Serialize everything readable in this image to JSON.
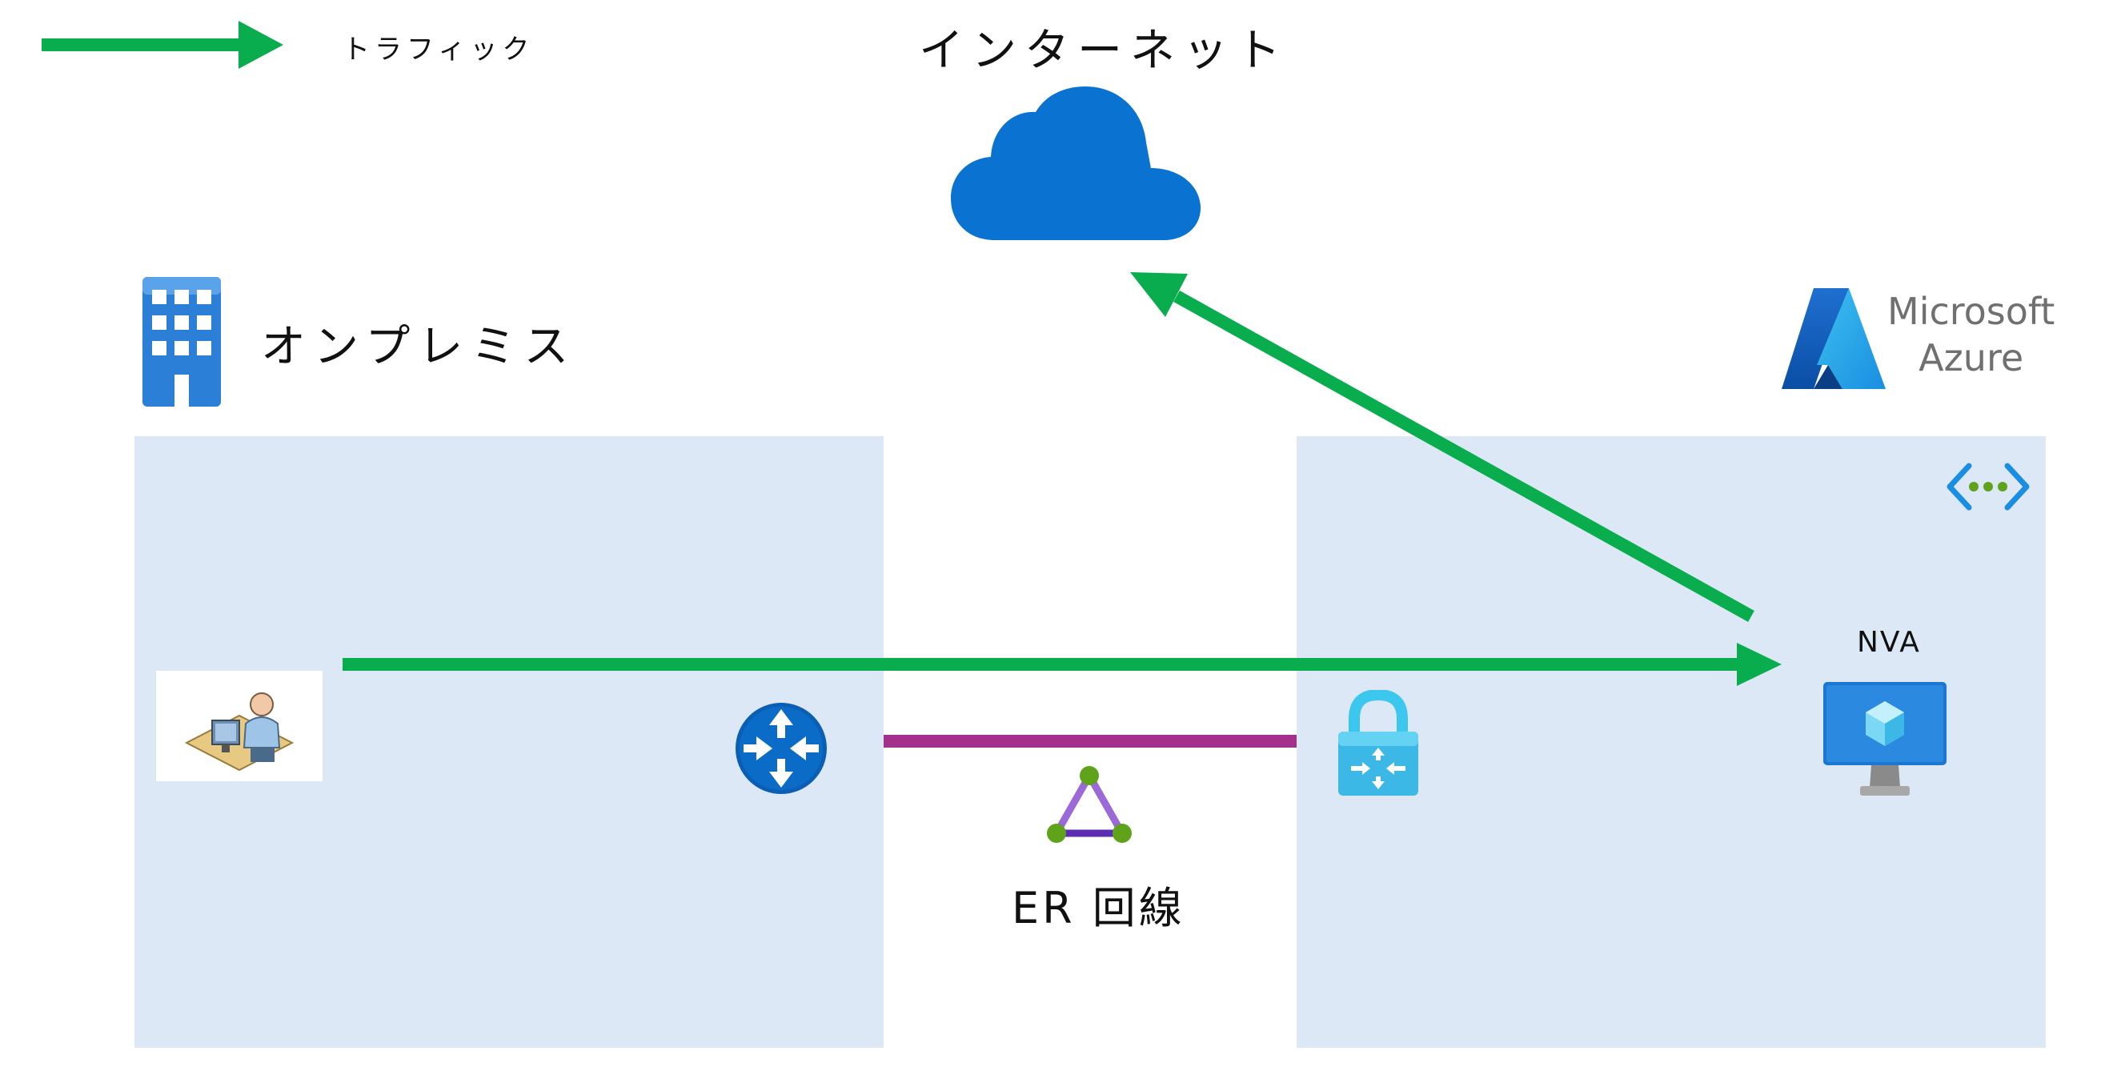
{
  "legend": {
    "label": "トラフィック",
    "arrow_color": "#0aad4e"
  },
  "internet": {
    "title": "インターネット",
    "icon": "cloud-icon",
    "color": "#0a72d0"
  },
  "onprem": {
    "title": "オンプレミス",
    "icon": "office-building-icon"
  },
  "azure": {
    "brand_line1": "Microsoft",
    "brand_line2": "Azure",
    "icon": "azure-logo-icon"
  },
  "er": {
    "label": "ER 回線",
    "line_color": "#a2308c",
    "icon": "expressroute-circuit-icon"
  },
  "nva": {
    "label": "NVA",
    "icon": "virtual-machine-icon"
  },
  "icons": {
    "client": "user-workstation-icon",
    "router": "router-icon",
    "gateway": "vpn-gateway-icon",
    "vnet": "virtual-network-icon"
  },
  "colors": {
    "panel": "#dce8f5",
    "traffic": "#0aad4e",
    "er_line": "#a2308c"
  }
}
